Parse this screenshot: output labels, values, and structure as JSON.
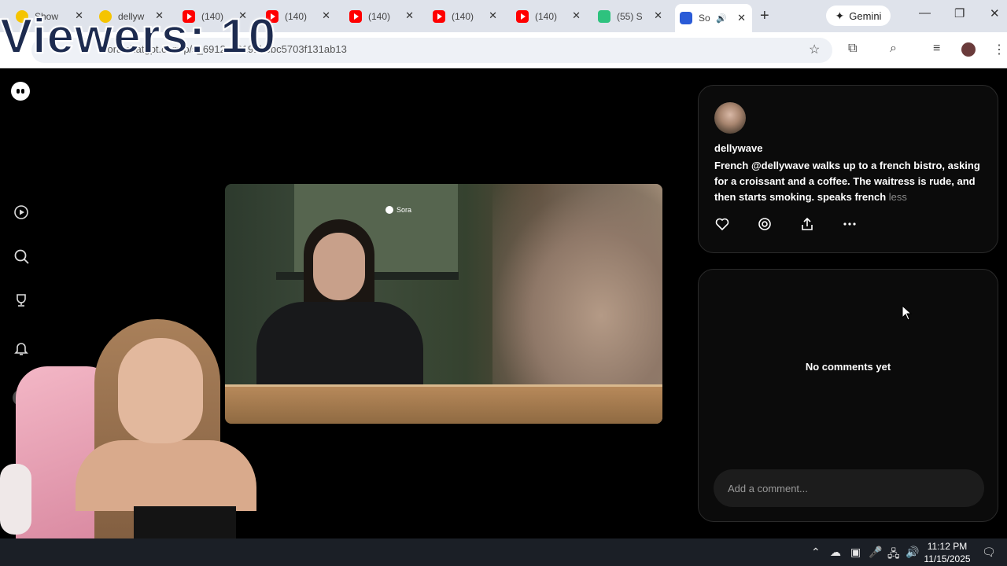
{
  "overlay": {
    "viewers_text": "Viewers: 10"
  },
  "tabs": [
    {
      "label": "Show",
      "favicon": "yellow-heart-icon"
    },
    {
      "label": "dellyw",
      "favicon": "yellow-heart-icon"
    },
    {
      "label": "(140)",
      "favicon": "youtube-icon"
    },
    {
      "label": "(140)",
      "favicon": "youtube-icon"
    },
    {
      "label": "(140)",
      "favicon": "youtube-icon"
    },
    {
      "label": "(140)",
      "favicon": "youtube-icon"
    },
    {
      "label": "(140)",
      "favicon": "youtube-icon"
    },
    {
      "label": "(55) S",
      "favicon": "green-app-icon"
    },
    {
      "label": "So",
      "favicon": "sora-icon",
      "active": true
    }
  ],
  "toolbar": {
    "url": "sora.chatgpt.com/p/s_6912c88191bebc5703f131ab13",
    "gemini_label": "Gemini"
  },
  "post": {
    "username": "dellywave",
    "desc_prefix": "French ",
    "mention": "@dellywave",
    "desc_suffix": " walks up to a french bistro, asking for a croissant and a coffee. The waitress is rude, and then starts smoking. speaks french ",
    "less_label": "less"
  },
  "video": {
    "watermark": "Sora"
  },
  "comments": {
    "empty_text": "No comments yet",
    "input_placeholder": "Add a comment..."
  },
  "taskbar": {
    "time": "11:12 PM",
    "date": "11/15/2025"
  }
}
